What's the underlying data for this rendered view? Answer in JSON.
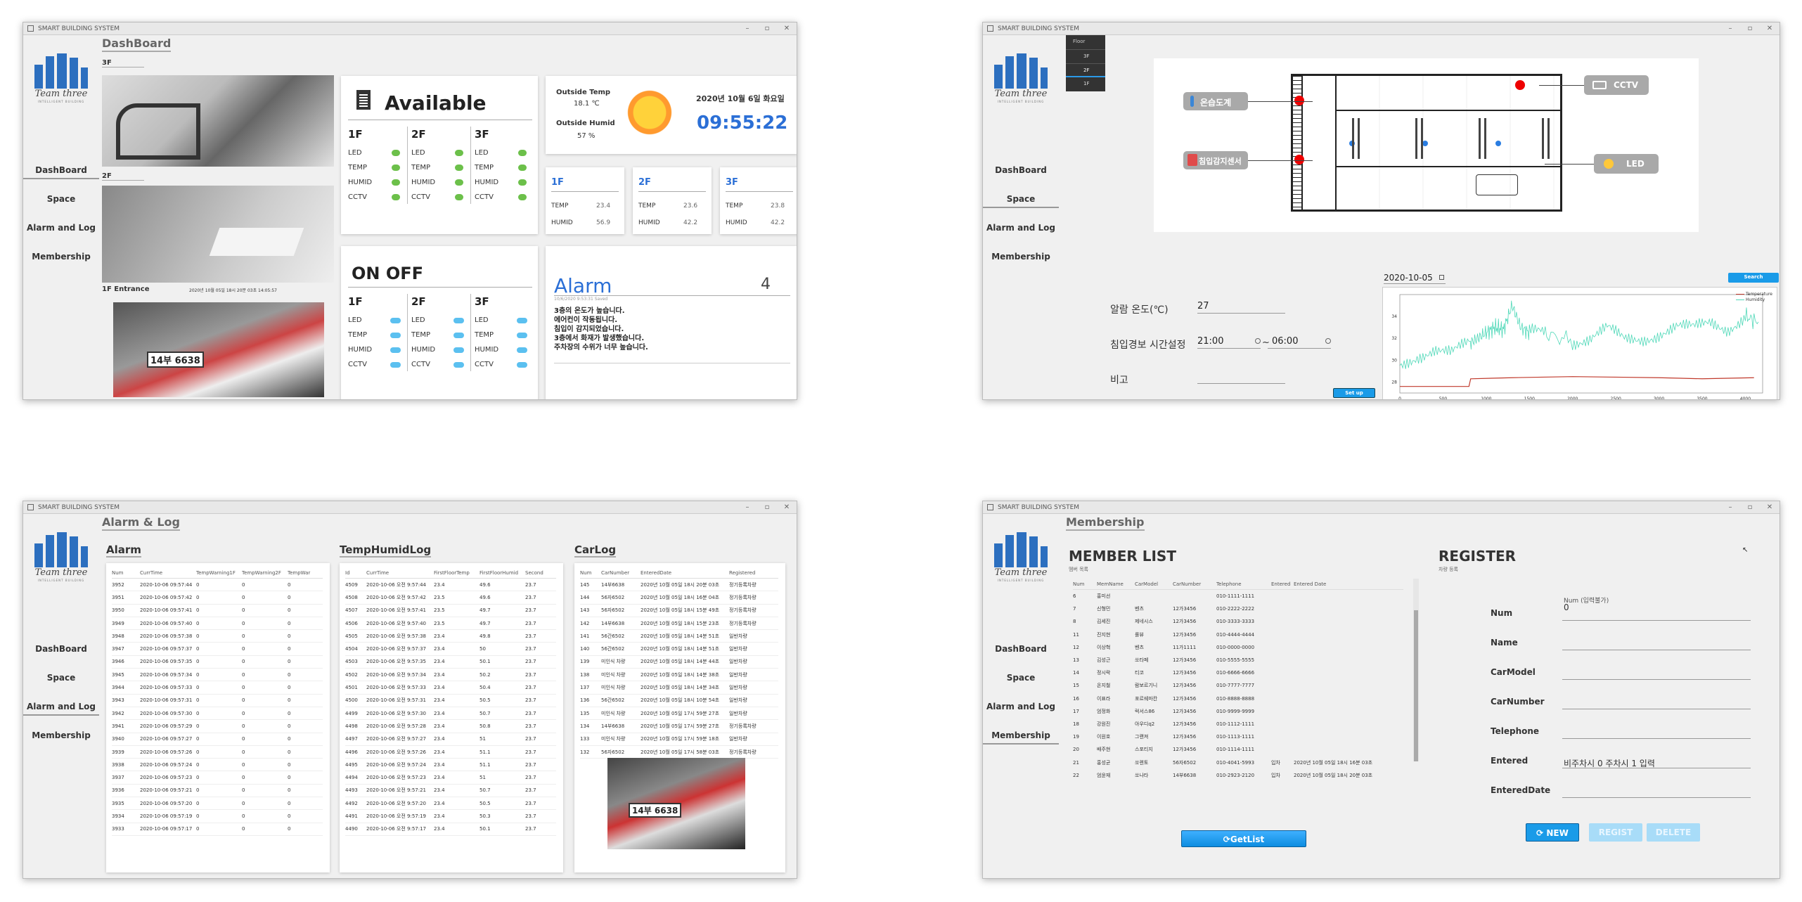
{
  "app_title": "SMART BUILDING SYSTEM",
  "logo": {
    "title": "Team three",
    "subtitle": "INTELLIGENT BUILDING"
  },
  "nav": [
    "DashBoard",
    "Space",
    "Alarm and Log",
    "Membership"
  ],
  "w1": {
    "page_title": "DashBoard",
    "cam": {
      "f3": "3F",
      "f2": "2F",
      "entrance": "1F Entrance",
      "entrance_time": "2020년 10월 05일 18시 20분 03초 14:05:57"
    },
    "plate": "14부 6638",
    "avail": {
      "title": "Available",
      "floors": [
        "1F",
        "2F",
        "3F"
      ],
      "items": [
        "LED",
        "TEMP",
        "HUMID",
        "CCTV"
      ]
    },
    "weather": {
      "temp_label": "Outside Temp",
      "temp": "18.1 ℃",
      "humid_label": "Outside Humid",
      "humid": "57  %",
      "date": "2020년 10월 6일 화요일",
      "time": "09:55:22"
    },
    "floor_env": [
      {
        "floor": "1F",
        "temp": "23.4",
        "humid": "56.9"
      },
      {
        "floor": "2F",
        "temp": "23.6",
        "humid": "42.2"
      },
      {
        "floor": "3F",
        "temp": "23.8",
        "humid": "42.2"
      }
    ],
    "env_labels": {
      "temp": "TEMP",
      "humid": "HUMID"
    },
    "onoff": {
      "title": "ON OFF",
      "floors": [
        "1F",
        "2F",
        "3F"
      ],
      "items": [
        "LED",
        "TEMP",
        "HUMID",
        "CCTV"
      ]
    },
    "alarm": {
      "title": "Alarm",
      "count": "4",
      "meta": "10/6/2020 9:53:31 Saved",
      "lines": [
        "3층의 온도가 높습니다.",
        "에어컨이 작동됩니다.",
        "침입이 감지되었습니다.",
        "3층에서 화재가 발생했습니다.",
        "주차장의 수위가 너무 높습니다."
      ]
    }
  },
  "w2": {
    "floor_menu": [
      "Floor",
      "3F",
      "2F",
      "1F"
    ],
    "btn_temp": "온습도계",
    "btn_intrusion": "침입감지센서",
    "btn_cctv": "CCTV",
    "btn_led": "LED",
    "date": "2020-10-05",
    "search": "Search",
    "alarm_temp_label": "알람 온도(℃)",
    "alarm_temp": "27",
    "intrusion_label": "침입경보 시간설정",
    "time_from": "21:00",
    "time_to": "06:00",
    "note_label": "비고",
    "setup": "Set up",
    "chart_legend": [
      "Temperature",
      "Humidity"
    ],
    "chart_data": {
      "type": "line",
      "title": "",
      "xlabel": "",
      "ylabel": "",
      "xlim": [
        0,
        4200
      ],
      "ylim": [
        27,
        36
      ],
      "x_ticks": [
        "0",
        "500",
        "1000",
        "1500",
        "2000",
        "2500",
        "3000",
        "3500",
        "4000"
      ],
      "y_ticks": [
        "28",
        "30",
        "32",
        "34"
      ],
      "series": [
        {
          "name": "Temperature",
          "values_desc": "flat near 27.5 rising to ~28.3 after 800",
          "x": [
            0,
            800,
            820,
            1300,
            2000,
            3000,
            3500,
            4100
          ],
          "values": [
            27.6,
            27.6,
            28.3,
            28.4,
            28.5,
            28.4,
            28.3,
            28.4
          ]
        },
        {
          "name": "Humidity",
          "x": [
            0,
            200,
            400,
            600,
            800,
            900,
            1000,
            1100,
            1200,
            1300,
            1400,
            1500,
            1700,
            2000,
            2200,
            2400,
            2600,
            2800,
            3000,
            3200,
            3400,
            3600,
            3800,
            4000,
            4150
          ],
          "values": [
            29.5,
            30.5,
            31,
            30.5,
            31.5,
            32,
            32.5,
            33,
            32.8,
            35,
            33,
            32.5,
            32.3,
            31.8,
            32,
            32.8,
            31.8,
            32,
            32.5,
            33,
            32.8,
            33.5,
            33,
            34,
            33.5
          ]
        }
      ]
    }
  },
  "w3": {
    "page_title": "Alarm & Log",
    "sec_alarm": "Alarm",
    "sec_temp": "TempHumidLog",
    "sec_car": "CarLog",
    "plate": "14부 6638",
    "alarm_cols": [
      "Num",
      "CurrTime",
      "TempWarning1F",
      "TempWarning2F",
      "TempWar"
    ],
    "alarm_rows": [
      [
        "3952",
        "2020-10-06 09:57:44",
        "0",
        "0",
        "0"
      ],
      [
        "3951",
        "2020-10-06 09:57:42",
        "0",
        "0",
        "0"
      ],
      [
        "3950",
        "2020-10-06 09:57:41",
        "0",
        "0",
        "0"
      ],
      [
        "3949",
        "2020-10-06 09:57:40",
        "0",
        "0",
        "0"
      ],
      [
        "3948",
        "2020-10-06 09:57:38",
        "0",
        "0",
        "0"
      ],
      [
        "3947",
        "2020-10-06 09:57:37",
        "0",
        "0",
        "0"
      ],
      [
        "3946",
        "2020-10-06 09:57:35",
        "0",
        "0",
        "0"
      ],
      [
        "3945",
        "2020-10-06 09:57:34",
        "0",
        "0",
        "0"
      ],
      [
        "3944",
        "2020-10-06 09:57:33",
        "0",
        "0",
        "0"
      ],
      [
        "3943",
        "2020-10-06 09:57:31",
        "0",
        "0",
        "0"
      ],
      [
        "3942",
        "2020-10-06 09:57:30",
        "0",
        "0",
        "0"
      ],
      [
        "3941",
        "2020-10-06 09:57:29",
        "0",
        "0",
        "0"
      ],
      [
        "3940",
        "2020-10-06 09:57:27",
        "0",
        "0",
        "0"
      ],
      [
        "3939",
        "2020-10-06 09:57:26",
        "0",
        "0",
        "0"
      ],
      [
        "3938",
        "2020-10-06 09:57:24",
        "0",
        "0",
        "0"
      ],
      [
        "3937",
        "2020-10-06 09:57:23",
        "0",
        "0",
        "0"
      ],
      [
        "3936",
        "2020-10-06 09:57:21",
        "0",
        "0",
        "0"
      ],
      [
        "3935",
        "2020-10-06 09:57:20",
        "0",
        "0",
        "0"
      ],
      [
        "3934",
        "2020-10-06 09:57:19",
        "0",
        "0",
        "0"
      ],
      [
        "3933",
        "2020-10-06 09:57:17",
        "0",
        "0",
        "0"
      ]
    ],
    "temp_cols": [
      "Id",
      "CurrTime",
      "FirstFloorTemp",
      "FirstFloorHumid",
      "Second"
    ],
    "temp_rows": [
      [
        "4509",
        "2020-10-06 오전 9:57:44",
        "23.4",
        "49.6",
        "23.7"
      ],
      [
        "4508",
        "2020-10-06 오전 9:57:42",
        "23.5",
        "49.6",
        "23.7"
      ],
      [
        "4507",
        "2020-10-06 오전 9:57:41",
        "23.5",
        "49.7",
        "23.7"
      ],
      [
        "4506",
        "2020-10-06 오전 9:57:40",
        "23.5",
        "49.7",
        "23.7"
      ],
      [
        "4505",
        "2020-10-06 오전 9:57:38",
        "23.4",
        "49.8",
        "23.7"
      ],
      [
        "4504",
        "2020-10-06 오전 9:57:37",
        "23.4",
        "50",
        "23.7"
      ],
      [
        "4503",
        "2020-10-06 오전 9:57:35",
        "23.4",
        "50.1",
        "23.7"
      ],
      [
        "4502",
        "2020-10-06 오전 9:57:34",
        "23.4",
        "50.2",
        "23.7"
      ],
      [
        "4501",
        "2020-10-06 오전 9:57:33",
        "23.4",
        "50.4",
        "23.7"
      ],
      [
        "4500",
        "2020-10-06 오전 9:57:31",
        "23.4",
        "50.5",
        "23.7"
      ],
      [
        "4499",
        "2020-10-06 오전 9:57:30",
        "23.4",
        "50.7",
        "23.7"
      ],
      [
        "4498",
        "2020-10-06 오전 9:57:28",
        "23.4",
        "50.8",
        "23.7"
      ],
      [
        "4497",
        "2020-10-06 오전 9:57:27",
        "23.4",
        "51",
        "23.7"
      ],
      [
        "4496",
        "2020-10-06 오전 9:57:26",
        "23.4",
        "51.1",
        "23.7"
      ],
      [
        "4495",
        "2020-10-06 오전 9:57:24",
        "23.4",
        "51.1",
        "23.7"
      ],
      [
        "4494",
        "2020-10-06 오전 9:57:23",
        "23.4",
        "51",
        "23.7"
      ],
      [
        "4493",
        "2020-10-06 오전 9:57:21",
        "23.4",
        "50.7",
        "23.7"
      ],
      [
        "4492",
        "2020-10-06 오전 9:57:20",
        "23.4",
        "50.5",
        "23.7"
      ],
      [
        "4491",
        "2020-10-06 오전 9:57:19",
        "23.4",
        "50.3",
        "23.7"
      ],
      [
        "4490",
        "2020-10-06 오전 9:57:17",
        "23.4",
        "50.1",
        "23.7"
      ]
    ],
    "car_cols": [
      "Num",
      "CarNumber",
      "EnteredDate",
      "Registered"
    ],
    "car_rows": [
      [
        "145",
        "14부6638",
        "2020년 10월 05일 18시 20분 03초",
        "정기등록차량"
      ],
      [
        "144",
        "56자6502",
        "2020년 10월 05일 18시 16분 04초",
        "정기등록차량"
      ],
      [
        "143",
        "56자6502",
        "2020년 10월 05일 18시 15분 49초",
        "정기등록차량"
      ],
      [
        "142",
        "14부6638",
        "2020년 10월 05일 18시 15분 23초",
        "정기등록차량"
      ],
      [
        "141",
        "56간6502",
        "2020년 10월 05일 18시 14분 51초",
        "일반차량"
      ],
      [
        "140",
        "56간6502",
        "2020년 10월 05일 18시 14분 51초",
        "일반차량"
      ],
      [
        "139",
        "미인식 차량",
        "2020년 10월 05일 18시 14분 44초",
        "일반차량"
      ],
      [
        "138",
        "미인식 차량",
        "2020년 10월 05일 18시 14분 38초",
        "일반차량"
      ],
      [
        "137",
        "미인식 차량",
        "2020년 10월 05일 18시 14분 34초",
        "일반차량"
      ],
      [
        "136",
        "56간6502",
        "2020년 10월 05일 18시 10분 54초",
        "일반차량"
      ],
      [
        "135",
        "미인식 차량",
        "2020년 10월 05일 17시 59분 27초",
        "일반차량"
      ],
      [
        "134",
        "14부6638",
        "2020년 10월 05일 17시 59분 27초",
        "정기등록차량"
      ],
      [
        "133",
        "미인식 차량",
        "2020년 10월 05일 17시 59분 18초",
        "일반차량"
      ],
      [
        "132",
        "56자6502",
        "2020년 10월 05일 17시 58분 03초",
        "정기등록차량"
      ]
    ]
  },
  "w4": {
    "page_title": "Membership",
    "list_title": "MEMBER LIST",
    "list_sub": "멤버 목록",
    "reg_title": "REGISTER",
    "reg_sub": "차량 등록",
    "cols": [
      "Num",
      "MemName",
      "CarModel",
      "CarNumber",
      "Telephone",
      "Entered",
      "Entered Date"
    ],
    "rows": [
      [
        "6",
        "홍미선",
        "",
        "",
        "010-1111-1111",
        "",
        ""
      ],
      [
        "7",
        "신형민",
        "벤츠",
        "12가3456",
        "010-2222-2222",
        "",
        ""
      ],
      [
        "8",
        "김세진",
        "제네시스",
        "12가3456",
        "010-3333-3333",
        "",
        ""
      ],
      [
        "11",
        "진지현",
        "롤뷰",
        "12가3456",
        "010-4444-4444",
        "",
        ""
      ],
      [
        "12",
        "이상혁",
        "벤츠",
        "11가1111",
        "010-0000-0000",
        "",
        ""
      ],
      [
        "13",
        "김성근",
        "쏘타페",
        "12가3456",
        "010-5555-5555",
        "",
        ""
      ],
      [
        "14",
        "정시락",
        "티코",
        "12가3456",
        "010-6666-6666",
        "",
        ""
      ],
      [
        "15",
        "온지철",
        "람보르기니",
        "12가3456",
        "010-7777-7777",
        "",
        ""
      ],
      [
        "16",
        "이표라",
        "포르쉐마칸",
        "12가3456",
        "010-8888-8888",
        "",
        ""
      ],
      [
        "17",
        "엄정화",
        "럭서스86",
        "12가3456",
        "010-9999-9999",
        "",
        ""
      ],
      [
        "18",
        "강원진",
        "아우디q2",
        "12가3456",
        "010-1112-1111",
        "",
        ""
      ],
      [
        "19",
        "이원호",
        "그랜져",
        "12가3456",
        "010-1113-1111",
        "",
        ""
      ],
      [
        "20",
        "배주현",
        "스포티지",
        "12가3456",
        "010-1114-1111",
        "",
        ""
      ],
      [
        "21",
        "홍성균",
        "쏘렌토",
        "56자6502",
        "010-4041-5993",
        "입차",
        "2020년 10월 05일 18시 16분 03초"
      ],
      [
        "22",
        "엄윤재",
        "쏘나타",
        "14부6638",
        "010-2923-2120",
        "입차",
        "2020년 10월 05일 18시 20분 03초"
      ]
    ],
    "getlist": "GetList",
    "fields": [
      "Num",
      "Name",
      "CarModel",
      "CarNumber",
      "Telephone",
      "Entered",
      "EnteredDate"
    ],
    "num_hint": "Num (입력불가)",
    "num_value": "0",
    "entered_value": "비주차시 0 주차시 1 입력",
    "btn_new": "NEW",
    "btn_regist": "REGIST",
    "btn_delete": "DELETE"
  },
  "colors": {
    "accent": "#2b6fd6",
    "time": "#2b6fd6",
    "btn": "#1a9be8",
    "temp_line": "#c0392b",
    "humid_line": "#4fd8b8"
  }
}
